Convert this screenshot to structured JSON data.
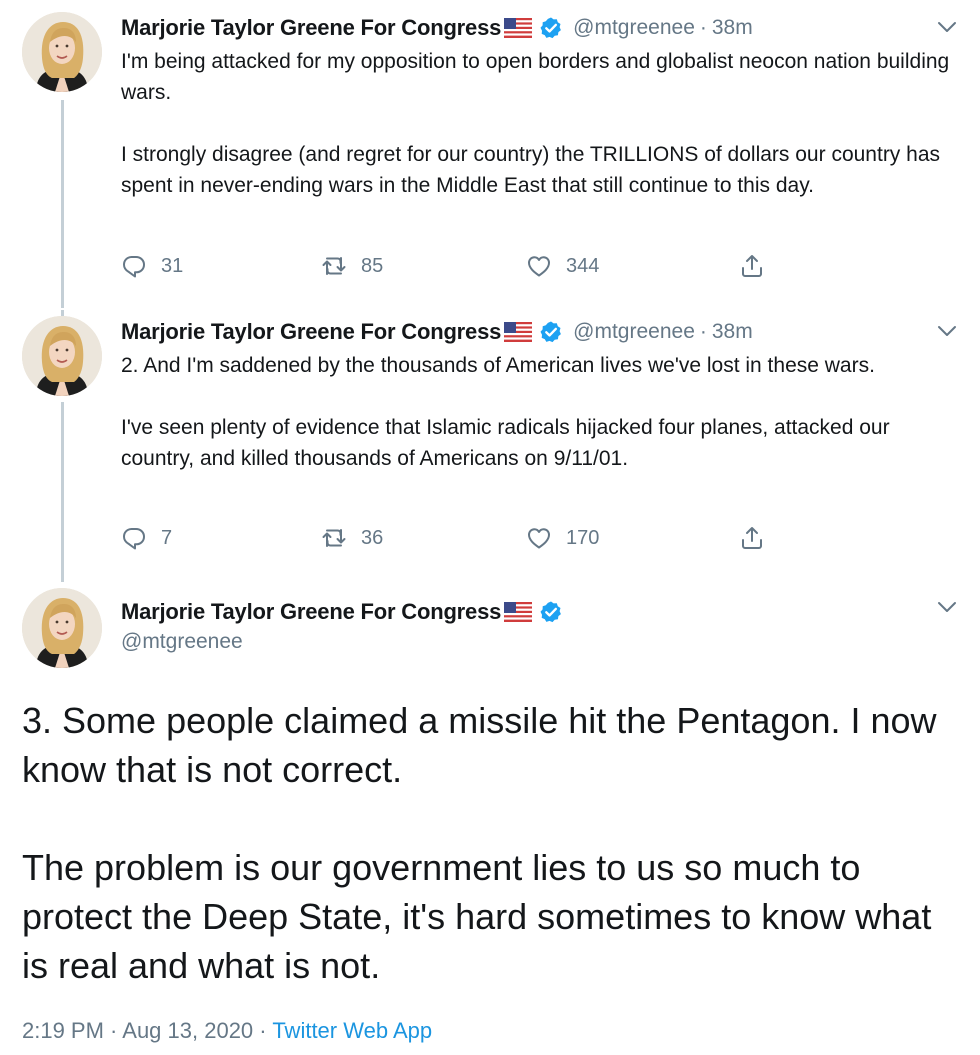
{
  "tweets": [
    {
      "name": "Marjorie Taylor Greene For Congress",
      "handle": "@mtgreenee",
      "separator": "·",
      "time": "38m",
      "paragraphs": [
        "I'm being attacked for my opposition to open borders and globalist neocon nation building wars.",
        "I strongly disagree (and regret for our country) the TRILLIONS of dollars our country has spent in never-ending wars in the Middle East that still continue to this day."
      ],
      "replies": "31",
      "retweets": "85",
      "likes": "344"
    },
    {
      "name": "Marjorie Taylor Greene For Congress",
      "handle": "@mtgreenee",
      "separator": "·",
      "time": "38m",
      "paragraphs": [
        "2. And I'm saddened by the thousands of American lives we've lost in these wars.",
        "I've seen plenty of evidence that Islamic radicals hijacked four planes, attacked our country, and killed thousands of Americans on 9/11/01."
      ],
      "replies": "7",
      "retweets": "36",
      "likes": "170"
    }
  ],
  "main_tweet": {
    "name": "Marjorie Taylor Greene For Congress",
    "handle": "@mtgreenee",
    "paragraphs": [
      "3. Some people claimed a missile hit the Pentagon.  I now know that is not correct.",
      "The problem is our government lies to us so much to protect the Deep State, it's hard sometimes to know what is real and what is not."
    ],
    "timestamp": "2:19 PM · Aug 13, 2020 · ",
    "source": "Twitter Web App"
  },
  "icons": {
    "reply": "reply-icon",
    "retweet": "retweet-icon",
    "like": "heart-icon",
    "share": "share-icon",
    "verified": "verified-badge-icon",
    "flag": "us-flag-icon",
    "caret": "chevron-down-icon"
  },
  "colors": {
    "text": "#14171a",
    "secondary": "#657786",
    "link": "#1b95e0",
    "verified": "#1da1f2",
    "thread_line": "#c4cfd6"
  }
}
